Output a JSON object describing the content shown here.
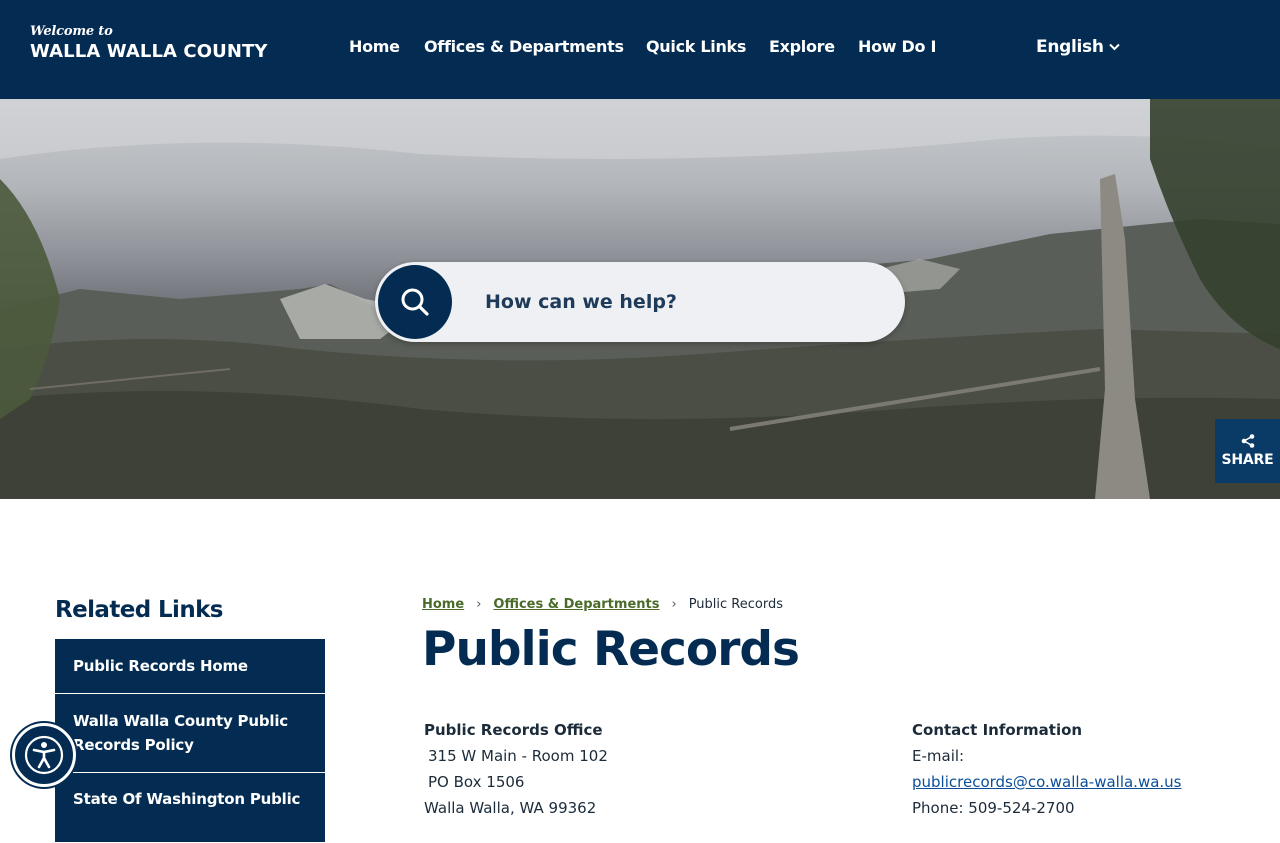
{
  "header": {
    "logo_welcome": "Welcome to",
    "logo_name": "WALLA WALLA COUNTY",
    "nav": [
      "Home",
      "Offices & Departments",
      "Quick Links",
      "Explore",
      "How Do I"
    ],
    "language": "English"
  },
  "search": {
    "placeholder": "How can we help?"
  },
  "share": {
    "label": "SHARE"
  },
  "related_links": {
    "title": "Related Links",
    "items": [
      "Public Records Home",
      "Walla Walla County Public Records Policy",
      "State Of Washington Public"
    ]
  },
  "breadcrumb": [
    "Home",
    "Offices & Departments",
    "Public Records"
  ],
  "page_title": "Public Records",
  "office": {
    "heading": "Public Records Office",
    "lines": [
      "315 W Main - Room 102",
      "PO Box 1506",
      "Walla Walla, WA 99362"
    ]
  },
  "contact": {
    "heading": "Contact Information",
    "email_label": "E-mail:",
    "email": "publicrecords@co.walla-walla.wa.us",
    "phone": "Phone: 509-524-2700"
  },
  "colors": {
    "navy": "#042c52",
    "breadcrumb_green": "#4a6b2a",
    "link_blue": "#0b4f9a"
  }
}
